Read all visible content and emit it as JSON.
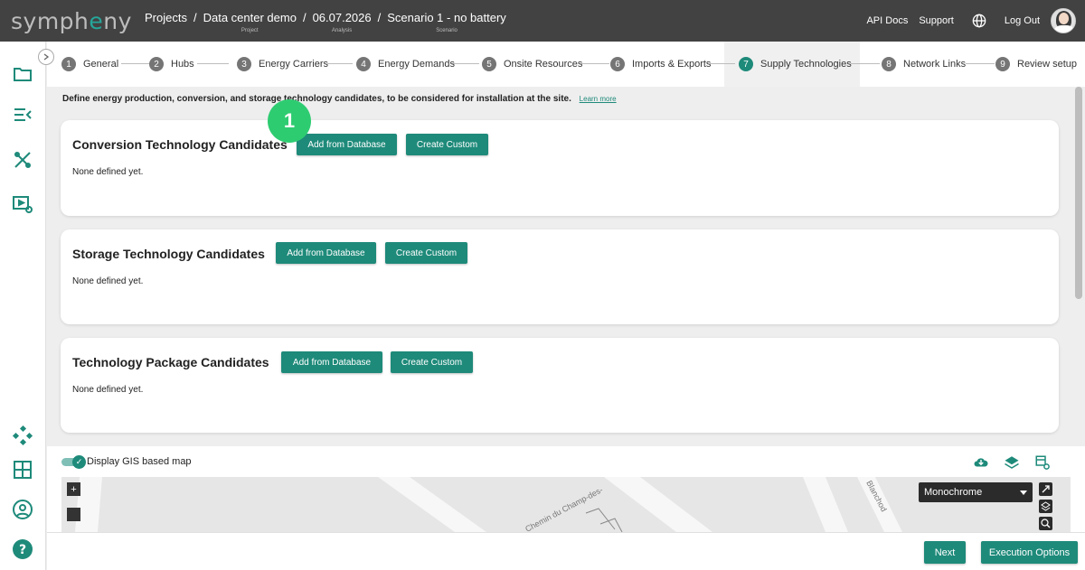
{
  "app": {
    "logo_prefix": "symph",
    "logo_accent": "e",
    "logo_suffix": "ny"
  },
  "breadcrumbs": [
    {
      "label": "Projects",
      "sub": ""
    },
    {
      "label": "Data center demo",
      "sub": "Project"
    },
    {
      "label": "06.07.2026",
      "sub": "Analysis"
    },
    {
      "label": "Scenario 1 - no battery",
      "sub": "Scenario"
    }
  ],
  "breadcrumb_separator": "/",
  "top_nav": {
    "api_docs": "API Docs",
    "support": "Support",
    "logout": "Log Out"
  },
  "steps": [
    {
      "num": "1",
      "label": "General"
    },
    {
      "num": "2",
      "label": "Hubs"
    },
    {
      "num": "3",
      "label": "Energy Carriers"
    },
    {
      "num": "4",
      "label": "Energy Demands"
    },
    {
      "num": "5",
      "label": "Onsite Resources"
    },
    {
      "num": "6",
      "label": "Imports & Exports"
    },
    {
      "num": "7",
      "label": "Supply Technologies"
    },
    {
      "num": "8",
      "label": "Network Links"
    },
    {
      "num": "9",
      "label": "Review setup"
    }
  ],
  "active_step": "7",
  "description": "Define energy production, conversion, and storage technology candidates, to be considered for installation at the site.",
  "learn_more": "Learn more",
  "callout": "1",
  "sections": [
    {
      "title": "Conversion Technology Candidates",
      "add": "Add from Database",
      "custom": "Create Custom",
      "empty": "None defined yet."
    },
    {
      "title": "Storage Technology Candidates",
      "add": "Add from Database",
      "custom": "Create Custom",
      "empty": "None defined yet."
    },
    {
      "title": "Technology Package Candidates",
      "add": "Add from Database",
      "custom": "Create Custom",
      "empty": "None defined yet."
    }
  ],
  "map": {
    "toggle_label": "Display GIS based map",
    "style_select": "Monochrome",
    "street_1": "Chemin du Champ-des-",
    "street_2": "Blanchod",
    "zoom_in": "+"
  },
  "footer": {
    "next": "Next",
    "execution_options": "Execution Options"
  },
  "colors": {
    "primary": "#1e8a7a",
    "topbar": "#424242",
    "callout": "#2ecc71"
  }
}
